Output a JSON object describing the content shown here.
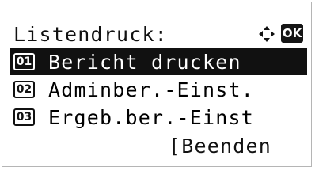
{
  "screen": {
    "title": "Listendruck:",
    "nav_icon": "four-way-arrow-icon",
    "ok_label": "OK"
  },
  "menu": {
    "items": [
      {
        "number": "01",
        "label": "Bericht drucken",
        "selected": true
      },
      {
        "number": "02",
        "label": "Adminber.-Einst.",
        "selected": false
      },
      {
        "number": "03",
        "label": "Ergeb.ber.-Einst",
        "selected": false
      }
    ]
  },
  "footer": {
    "exit_label": "[Beenden"
  },
  "colors": {
    "highlight_bg": "#111111",
    "highlight_fg": "#ffffff",
    "text": "#111111",
    "background": "#ffffff"
  }
}
